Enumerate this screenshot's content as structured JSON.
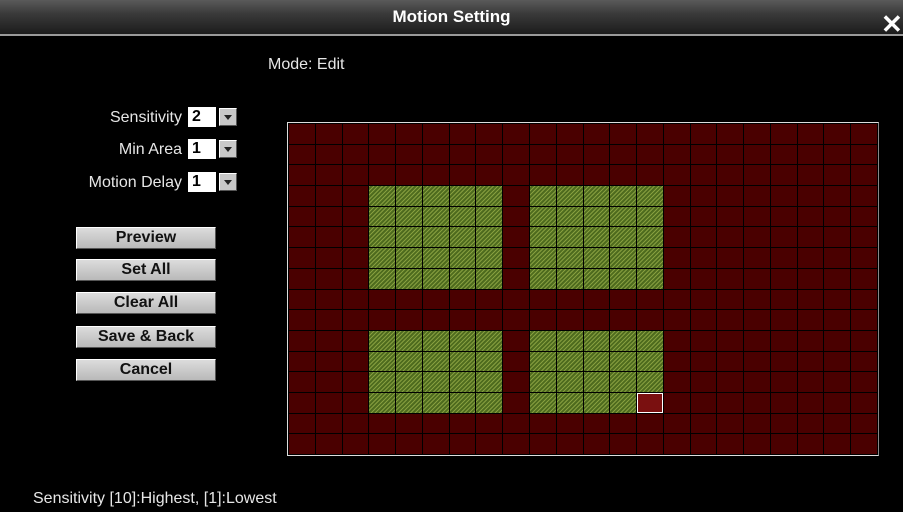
{
  "window": {
    "title": "Motion Setting",
    "close_symbol": "✕"
  },
  "mode_label": "Mode: Edit",
  "controls": {
    "sensitivity": {
      "label": "Sensitivity",
      "value": "2"
    },
    "min_area": {
      "label": "Min Area",
      "value": "1"
    },
    "motion_delay": {
      "label": "Motion Delay",
      "value": "1"
    }
  },
  "buttons": {
    "preview": "Preview",
    "set_all": "Set All",
    "clear_all": "Clear All",
    "save_back": "Save & Back",
    "cancel": "Cancel"
  },
  "grid": {
    "columns": 22,
    "rows": 16,
    "active_regions": [
      {
        "col_start": 3,
        "col_end": 7,
        "row_start": 3,
        "row_end": 7
      },
      {
        "col_start": 9,
        "col_end": 13,
        "row_start": 3,
        "row_end": 7
      },
      {
        "col_start": 3,
        "col_end": 7,
        "row_start": 10,
        "row_end": 13
      },
      {
        "col_start": 9,
        "col_end": 13,
        "row_start": 10,
        "row_end": 13
      }
    ],
    "cursor_cell": {
      "col": 13,
      "row": 13
    },
    "colors": {
      "inactive": "#4a0000",
      "active": "#4e6b1e",
      "cursor_border": "#ffffff"
    }
  },
  "footer_hint": "Sensitivity [10]:Highest, [1]:Lowest"
}
